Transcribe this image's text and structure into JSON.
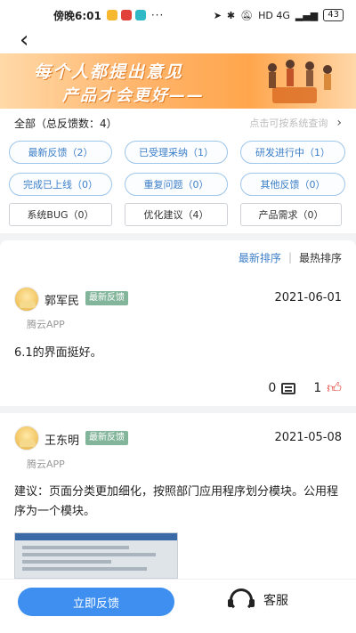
{
  "status_bar": {
    "time": "傍晚6:01",
    "more": "···",
    "signal_right": "HD 4G",
    "battery": "43"
  },
  "banner": {
    "line1": "每个人都提出意见",
    "line2": "产品才会更好——"
  },
  "filter": {
    "summary": "全部（总反馈数：4）",
    "hint": "点击可按系统查询",
    "chevron": "›",
    "pills": [
      "最新反馈（2）",
      "已受理采纳（1）",
      "研发进行中（1）",
      "完成已上线（0）",
      "重复问题（0）",
      "其他反馈（0）"
    ],
    "boxes": [
      "系统BUG（0）",
      "优化建议（4）",
      "产品需求（0）"
    ]
  },
  "sort": {
    "latest": "最新排序",
    "separator": "|",
    "hottest": "最热排序"
  },
  "feedback": [
    {
      "user": "郭军民",
      "tag": "最新反馈",
      "date": "2021-06-01",
      "source": "腾云APP",
      "content": "6.1的界面挺好。",
      "comments": "0",
      "likes": "1"
    },
    {
      "user": "王东明",
      "tag": "最新反馈",
      "date": "2021-05-08",
      "source": "腾云APP",
      "content": "建议：页面分类更加细化，按照部门应用程序划分模块。公用程序为一个模块。"
    }
  ],
  "bottom": {
    "submit": "立即反馈",
    "service": "客服"
  },
  "colors": {
    "accent": "#3e8ff0",
    "pill_text": "#3d7fc7",
    "tag_bg": "#83b59b",
    "like": "#e23a2e"
  }
}
